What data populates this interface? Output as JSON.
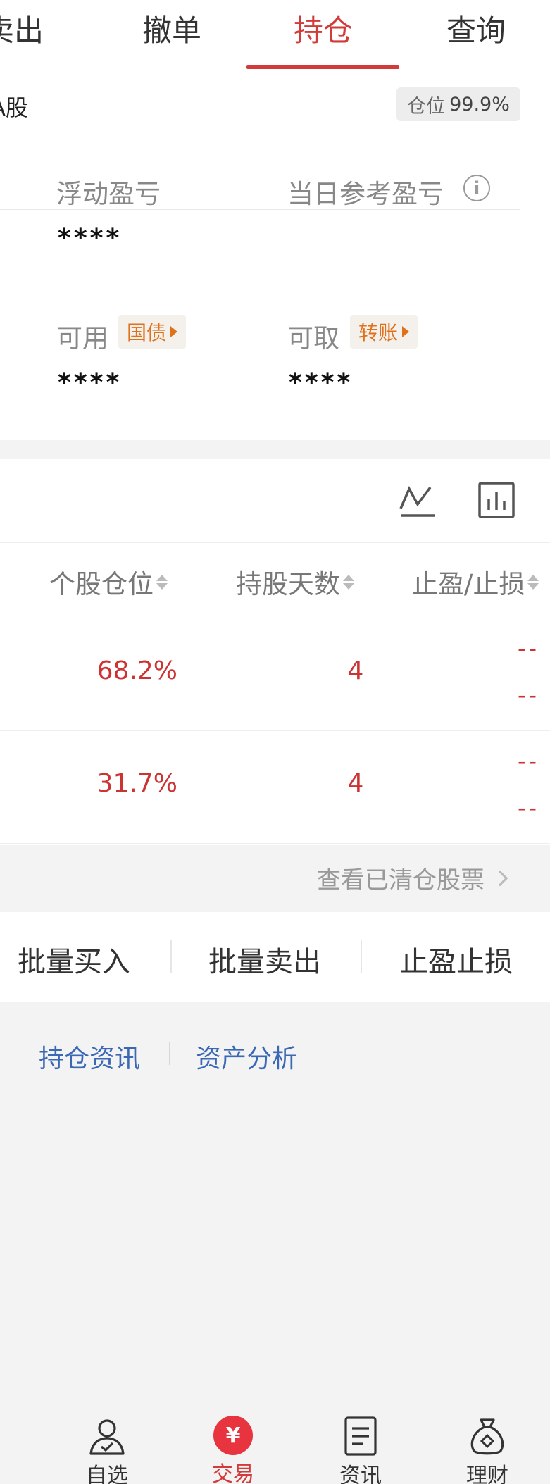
{
  "tabs": [
    {
      "label": "卖出"
    },
    {
      "label": "撤单"
    },
    {
      "label": "持仓"
    },
    {
      "label": "查询"
    }
  ],
  "account": {
    "name_fragment": "A股",
    "position_label": "仓位",
    "position_value": "99.9%",
    "floating_pnl_label": "浮动盈亏",
    "floating_pnl_value": "****",
    "daily_ref_pnl_label": "当日参考盈亏",
    "available_label": "可用",
    "available_tag": "国债",
    "available_value": "****",
    "withdrawable_label": "可取",
    "withdrawable_tag": "转账",
    "withdrawable_value": "****"
  },
  "table": {
    "headers": [
      "个股仓位",
      "持股天数",
      "止盈/止损"
    ],
    "rows": [
      {
        "position_pct": "68.2%",
        "days": "4",
        "stop": "--"
      },
      {
        "position_pct": "31.7%",
        "days": "4",
        "stop": "--"
      }
    ]
  },
  "cleared_link": "查看已清仓股票",
  "actions": [
    "批量买入",
    "批量卖出",
    "止盈止损"
  ],
  "links": [
    "持仓资讯",
    "资产分析"
  ],
  "nav": [
    {
      "label": "自选",
      "icon": "user-check-icon"
    },
    {
      "label": "交易",
      "icon": "yuan-circle-icon"
    },
    {
      "label": "资讯",
      "icon": "document-icon"
    },
    {
      "label": "理财",
      "icon": "money-bag-icon"
    }
  ],
  "colors": {
    "accent_red": "#d33a3a",
    "tag_orange": "#e0701a",
    "link_blue": "#3a68b4"
  }
}
